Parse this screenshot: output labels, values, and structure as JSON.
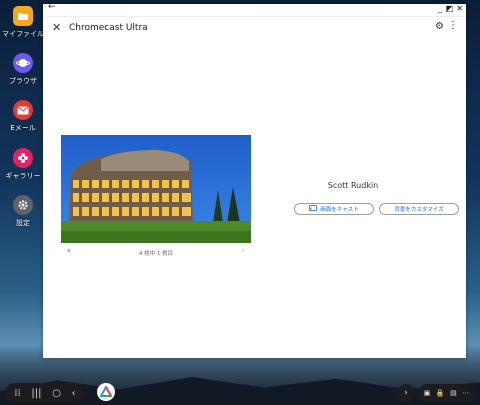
{
  "desktop": {
    "icons": [
      {
        "label": "マイファイル",
        "icon": "folder-icon",
        "color": "#f4a81d"
      },
      {
        "label": "ブラウザ",
        "icon": "planet-icon",
        "color": "#6b5cf0"
      },
      {
        "label": "Eメール",
        "icon": "mail-icon",
        "color": "#e53935"
      },
      {
        "label": "ギャラリー",
        "icon": "flower-icon",
        "color": "#e91e63"
      },
      {
        "label": "設定",
        "icon": "gear-icon",
        "color": "#5f6368"
      }
    ]
  },
  "window": {
    "title": "Chromecast Ultra",
    "photo": {
      "author": "Scott Rudkin",
      "counter": "4 枚中 1 枚目"
    },
    "actions": {
      "cast_label": "画面をキャスト",
      "customize_label": "背景をカスタマイズ"
    }
  },
  "colors": {
    "accent": "#1a73e8"
  }
}
